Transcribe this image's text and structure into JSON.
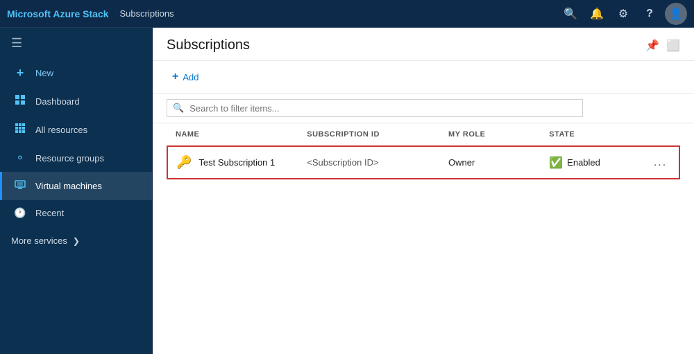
{
  "topbar": {
    "brand": "Microsoft Azure Stack",
    "tab_title": "Subscriptions"
  },
  "sidebar": {
    "hamburger_icon": "☰",
    "items": [
      {
        "id": "new",
        "label": "New",
        "icon": "＋",
        "active": false,
        "is_new": true
      },
      {
        "id": "dashboard",
        "label": "Dashboard",
        "icon": "▦",
        "active": false
      },
      {
        "id": "all-resources",
        "label": "All resources",
        "icon": "⊞",
        "active": false
      },
      {
        "id": "resource-groups",
        "label": "Resource groups",
        "icon": "◈",
        "active": false
      },
      {
        "id": "virtual-machines",
        "label": "Virtual machines",
        "icon": "🖥",
        "active": true
      },
      {
        "id": "recent",
        "label": "Recent",
        "icon": "🕐",
        "active": false
      }
    ],
    "more_services_label": "More services",
    "chevron": "❯"
  },
  "content": {
    "title": "Subscriptions",
    "add_button_label": "Add",
    "add_plus": "+",
    "search_placeholder": "Search to filter items...",
    "table": {
      "columns": [
        "NAME",
        "SUBSCRIPTION ID",
        "MY ROLE",
        "STATE"
      ],
      "rows": [
        {
          "icon": "key",
          "name": "Test Subscription 1",
          "subscription_id": "<Subscription ID>",
          "role": "Owner",
          "state": "Enabled",
          "state_icon": "✔",
          "actions": "..."
        }
      ]
    }
  },
  "icons": {
    "search": "🔍",
    "bell": "🔔",
    "gear": "⚙",
    "question": "?",
    "user": "👤",
    "pin": "📌"
  }
}
